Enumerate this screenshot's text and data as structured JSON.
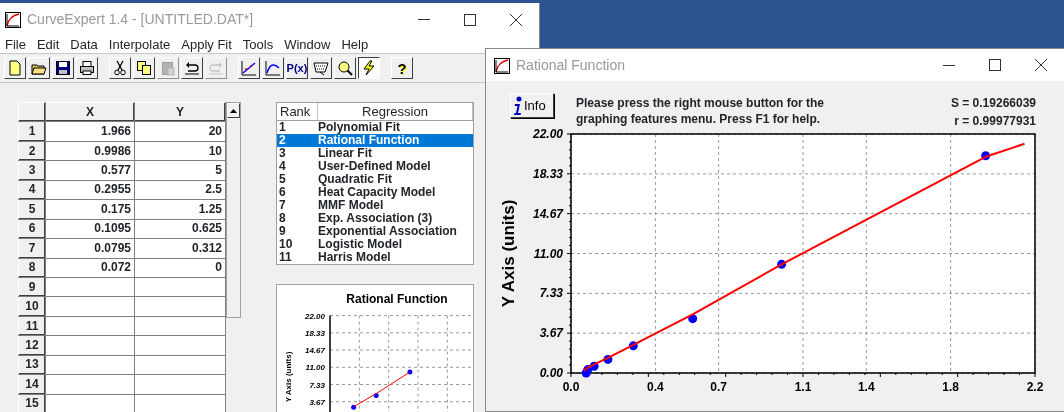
{
  "main_window": {
    "title": "CurveExpert 1.4 - [UNTITLED.DAT*]"
  },
  "menu": [
    "File",
    "Edit",
    "Data",
    "Interpolate",
    "Apply Fit",
    "Tools",
    "Window",
    "Help"
  ],
  "toolbar": [
    [
      {
        "disabled": false,
        "pressed": false
      },
      {
        "disabled": false,
        "pressed": false
      },
      {
        "disabled": false,
        "pressed": false
      },
      {
        "disabled": false,
        "pressed": false
      }
    ],
    [
      {
        "disabled": false,
        "pressed": false
      },
      {
        "disabled": false,
        "pressed": false
      },
      {
        "disabled": true,
        "pressed": false
      },
      {
        "disabled": false,
        "pressed": false
      },
      {
        "disabled": true,
        "pressed": false
      }
    ],
    [
      {
        "disabled": false,
        "pressed": false
      },
      {
        "disabled": false,
        "pressed": false
      },
      {
        "disabled": false,
        "pressed": false,
        "label": "P(x)"
      },
      {
        "disabled": false,
        "pressed": false
      },
      {
        "disabled": false,
        "pressed": false
      },
      {
        "disabled": false,
        "pressed": true
      }
    ],
    [
      {
        "disabled": false,
        "pressed": false,
        "label": "?"
      }
    ]
  ],
  "table": {
    "columns": [
      "X",
      "Y"
    ],
    "rows": [
      {
        "header": "1",
        "cells": [
          "1.966",
          "20"
        ]
      },
      {
        "header": "2",
        "cells": [
          "0.9986",
          "10"
        ]
      },
      {
        "header": "3",
        "cells": [
          "0.577",
          "5"
        ]
      },
      {
        "header": "4",
        "cells": [
          "0.2955",
          "2.5"
        ]
      },
      {
        "header": "5",
        "cells": [
          "0.175",
          "1.25"
        ]
      },
      {
        "header": "6",
        "cells": [
          "0.1095",
          "0.625"
        ]
      },
      {
        "header": "7",
        "cells": [
          "0.0795",
          "0.312"
        ]
      },
      {
        "header": "8",
        "cells": [
          "0.072",
          "0"
        ]
      },
      {
        "header": "9"
      },
      {
        "header": "10"
      },
      {
        "header": "11"
      },
      {
        "header": "12"
      },
      {
        "header": "13"
      },
      {
        "header": "14"
      },
      {
        "header": "15"
      }
    ]
  },
  "ranking": {
    "columns": [
      "Rank",
      "Regression"
    ],
    "rows": [
      {
        "rank": "1",
        "name": "Polynomial Fit",
        "selected": false
      },
      {
        "rank": "2",
        "name": "Rational Function",
        "selected": true
      },
      {
        "rank": "3",
        "name": "Linear Fit",
        "selected": false
      },
      {
        "rank": "4",
        "name": "User-Defined Model",
        "selected": false
      },
      {
        "rank": "5",
        "name": "Quadratic Fit",
        "selected": false
      },
      {
        "rank": "6",
        "name": "Heat Capacity Model",
        "selected": false
      },
      {
        "rank": "7",
        "name": "MMF Model",
        "selected": false
      },
      {
        "rank": "8",
        "name": "Exp. Association (3)",
        "selected": false
      },
      {
        "rank": "9",
        "name": "Exponential Association",
        "selected": false
      },
      {
        "rank": "10",
        "name": "Logistic Model",
        "selected": false
      },
      {
        "rank": "11",
        "name": "Harris Model",
        "selected": false
      }
    ]
  },
  "thumbnail": {
    "title": "Rational Function",
    "ylabel": "Y Axis (units)",
    "tick_labels": [
      "22.00",
      "18.33",
      "14.67",
      "11.00",
      "7.33",
      "3.67"
    ]
  },
  "graph_window": {
    "title": "Rational Function",
    "info_button": "Info",
    "message": "Please press the right mouse button for the\ngraphing features menu.  Press F1 for help.",
    "stats": [
      "S = 0.19266039",
      "r = 0.99977931"
    ],
    "chart_data": {
      "type": "scatter",
      "ylabel": "Y Axis (units)",
      "xlim": [
        0,
        2.2
      ],
      "ylim": [
        0,
        22
      ],
      "grid": true,
      "x": [
        0.06,
        0.072,
        0.0795,
        0.1095,
        0.175,
        0.2955,
        0.577,
        0.9986,
        1.966,
        2.15
      ],
      "series": [
        {
          "type": "scatter",
          "color": "#0000ff",
          "values": [
            null,
            0,
            0.312,
            0.625,
            1.25,
            2.5,
            5,
            10,
            20,
            null
          ]
        },
        {
          "type": "line",
          "color": "#ff0000",
          "values": [
            0.2,
            0.4,
            0.5,
            0.8,
            1.4,
            2.6,
            5.4,
            10.0,
            19.9,
            21.1
          ]
        }
      ],
      "xticks": [
        {
          "value": 0,
          "label": "0.0"
        },
        {
          "value": 0.4,
          "label": "0.4"
        },
        {
          "value": 0.7,
          "label": "0.7"
        },
        {
          "value": 1.1,
          "label": "1.1"
        },
        {
          "value": 1.4,
          "label": "1.4"
        },
        {
          "value": 1.8,
          "label": "1.8"
        },
        {
          "value": 2.2,
          "label": "2.2"
        }
      ],
      "yticks": [
        {
          "value": 0,
          "label": "0.00"
        },
        {
          "value": 3.67,
          "label": "3.67"
        },
        {
          "value": 7.33,
          "label": "7.33"
        },
        {
          "value": 11,
          "label": "11.00"
        },
        {
          "value": 14.67,
          "label": "14.67"
        },
        {
          "value": 18.33,
          "label": "18.33"
        },
        {
          "value": 22,
          "label": "22.00"
        }
      ]
    }
  }
}
